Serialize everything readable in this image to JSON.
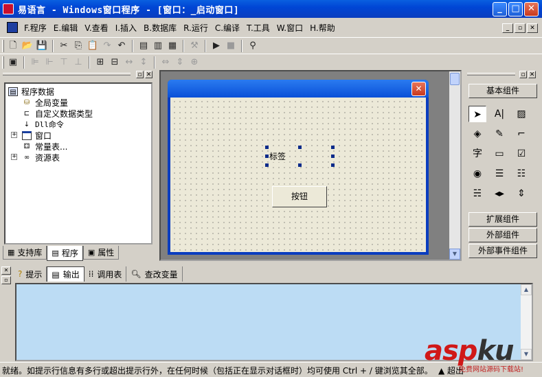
{
  "window": {
    "title": "易语言 - Windows窗口程序 - [窗口：_启动窗口]",
    "min_label": "_",
    "max_label": "□",
    "close_label": "✕"
  },
  "menubar": {
    "items": [
      "F.程序",
      "E.编辑",
      "V.查看",
      "I.插入",
      "B.数据库",
      "R.运行",
      "C.编译",
      "T.工具",
      "W.窗口",
      "H.帮助"
    ],
    "mdi": [
      "_",
      "▫",
      "✕"
    ]
  },
  "toolbar1": {
    "icons": [
      "new-file-icon",
      "open-folder-icon",
      "save-icon",
      "cut-icon",
      "copy-icon",
      "paste-icon",
      "redo-icon",
      "undo-icon",
      "layout1-icon",
      "layout2-icon",
      "layout3-icon",
      "tool-icon",
      "run-icon",
      "stop-icon",
      "binoculars-icon"
    ]
  },
  "left_panel": {
    "tree": [
      {
        "label": "程序数据",
        "icon": "program-data-icon"
      },
      {
        "label": "全局变量",
        "icon": "global-var-icon"
      },
      {
        "label": "自定义数据类型",
        "icon": "custom-type-icon"
      },
      {
        "label": "Dll命令",
        "icon": "dll-icon"
      },
      {
        "label": "窗口",
        "icon": "window-icon"
      },
      {
        "label": "常量表...",
        "icon": "constants-icon"
      },
      {
        "label": "资源表",
        "icon": "resources-icon"
      }
    ],
    "tabs": [
      "支持库",
      "程序",
      "属性"
    ]
  },
  "designer": {
    "label_text": "标签",
    "button_text": "按钮",
    "close_label": "✕"
  },
  "right_panel": {
    "categories": {
      "basic": "基本组件",
      "ext": "扩展组件",
      "external": "外部组件",
      "events": "外部事件组件"
    },
    "components": [
      "arrow-pointer-icon",
      "label-icon",
      "picture-icon",
      "shape-icon",
      "draw-icon",
      "edit-box-icon",
      "text-icon",
      "button-icon",
      "checkbox-icon",
      "radio-icon",
      "listbox-icon",
      "combo-icon",
      "grid-icon",
      "scroll-icon",
      "spin-icon"
    ],
    "glyphs": [
      "➤",
      "A|",
      "▨",
      "◈",
      "✎",
      "⌐",
      "字",
      "▭",
      "☑",
      "◉",
      "☰",
      "☷",
      "☵",
      "◂▸",
      "⇕"
    ]
  },
  "bottom_panel": {
    "tabs": [
      "提示",
      "输出",
      "调用表",
      "查改变量"
    ]
  },
  "status": {
    "text": "就绪。如提示行信息有多行或超出提示行外，在任何时候（包括正在显示对话框时）均可使用 Ctrl + / 键浏览其全部。",
    "right": "▲ 超出"
  },
  "watermark": {
    "logo": "asp",
    "logo2": "ku",
    "sub": "免费网站源码下载站!"
  }
}
